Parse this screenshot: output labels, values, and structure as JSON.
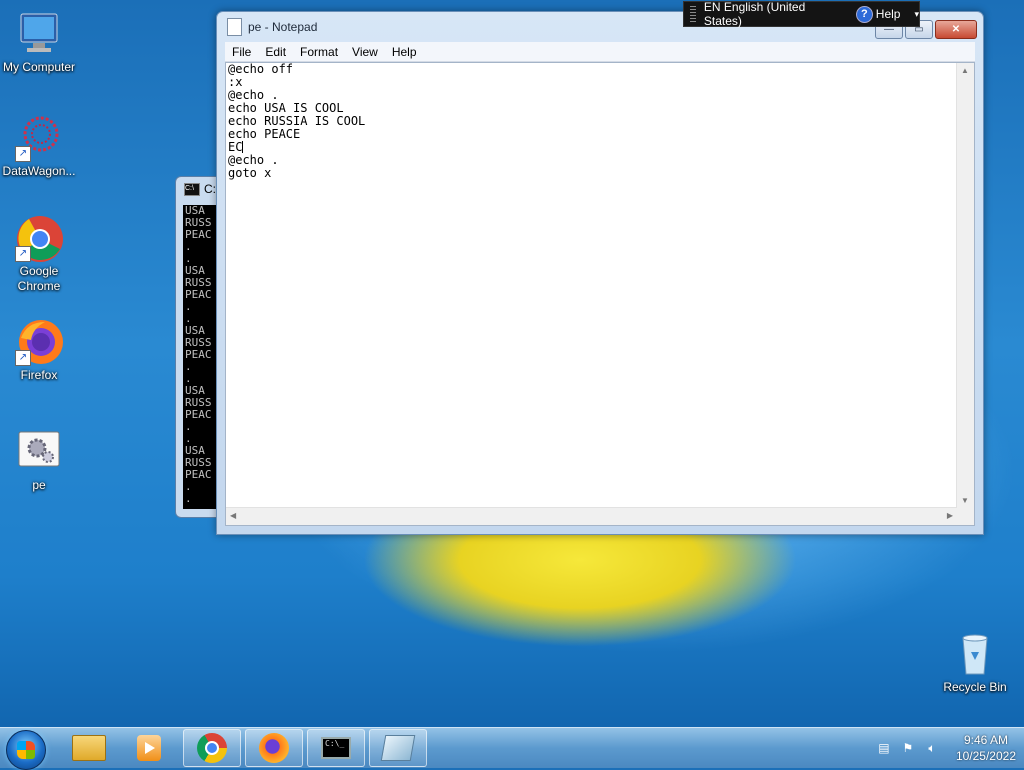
{
  "desktop": {
    "icons": [
      {
        "label": "My Computer",
        "icon": "computer-icon"
      },
      {
        "label": "DataWagon...",
        "icon": "datawagon-icon"
      },
      {
        "label": "Google Chrome",
        "icon": "chrome-icon"
      },
      {
        "label": "Firefox",
        "icon": "firefox-icon"
      },
      {
        "label": "pe",
        "icon": "batch-file-icon"
      },
      {
        "label": "Recycle Bin",
        "icon": "recycle-bin-icon"
      }
    ]
  },
  "cmd": {
    "title": "C:",
    "output": "USA\nRUSS\nPEAC\n.\n.\nUSA\nRUSS\nPEAC\n.\n.\nUSA\nRUSS\nPEAC\n.\n.\nUSA\nRUSS\nPEAC\n.\n.\nUSA\nRUSS\nPEAC\n.\n."
  },
  "notepad": {
    "title": "pe - Notepad",
    "menu": [
      "File",
      "Edit",
      "Format",
      "View",
      "Help"
    ],
    "text_before_caret": "@echo off\n:x\n@echo .\necho USA IS COOL\necho RUSSIA IS COOL\necho PEACE\nEC",
    "text_after_caret": "\n@echo .\ngoto x"
  },
  "langbar": {
    "language": "EN English (United States)",
    "help": "Help"
  },
  "taskbar": {
    "pinned": [
      "windows-explorer-icon",
      "media-player-icon",
      "chrome-icon",
      "firefox-icon",
      "cmd-icon",
      "notepad-icon"
    ]
  },
  "clock": {
    "time": "9:46 AM",
    "date": "10/25/2022"
  }
}
